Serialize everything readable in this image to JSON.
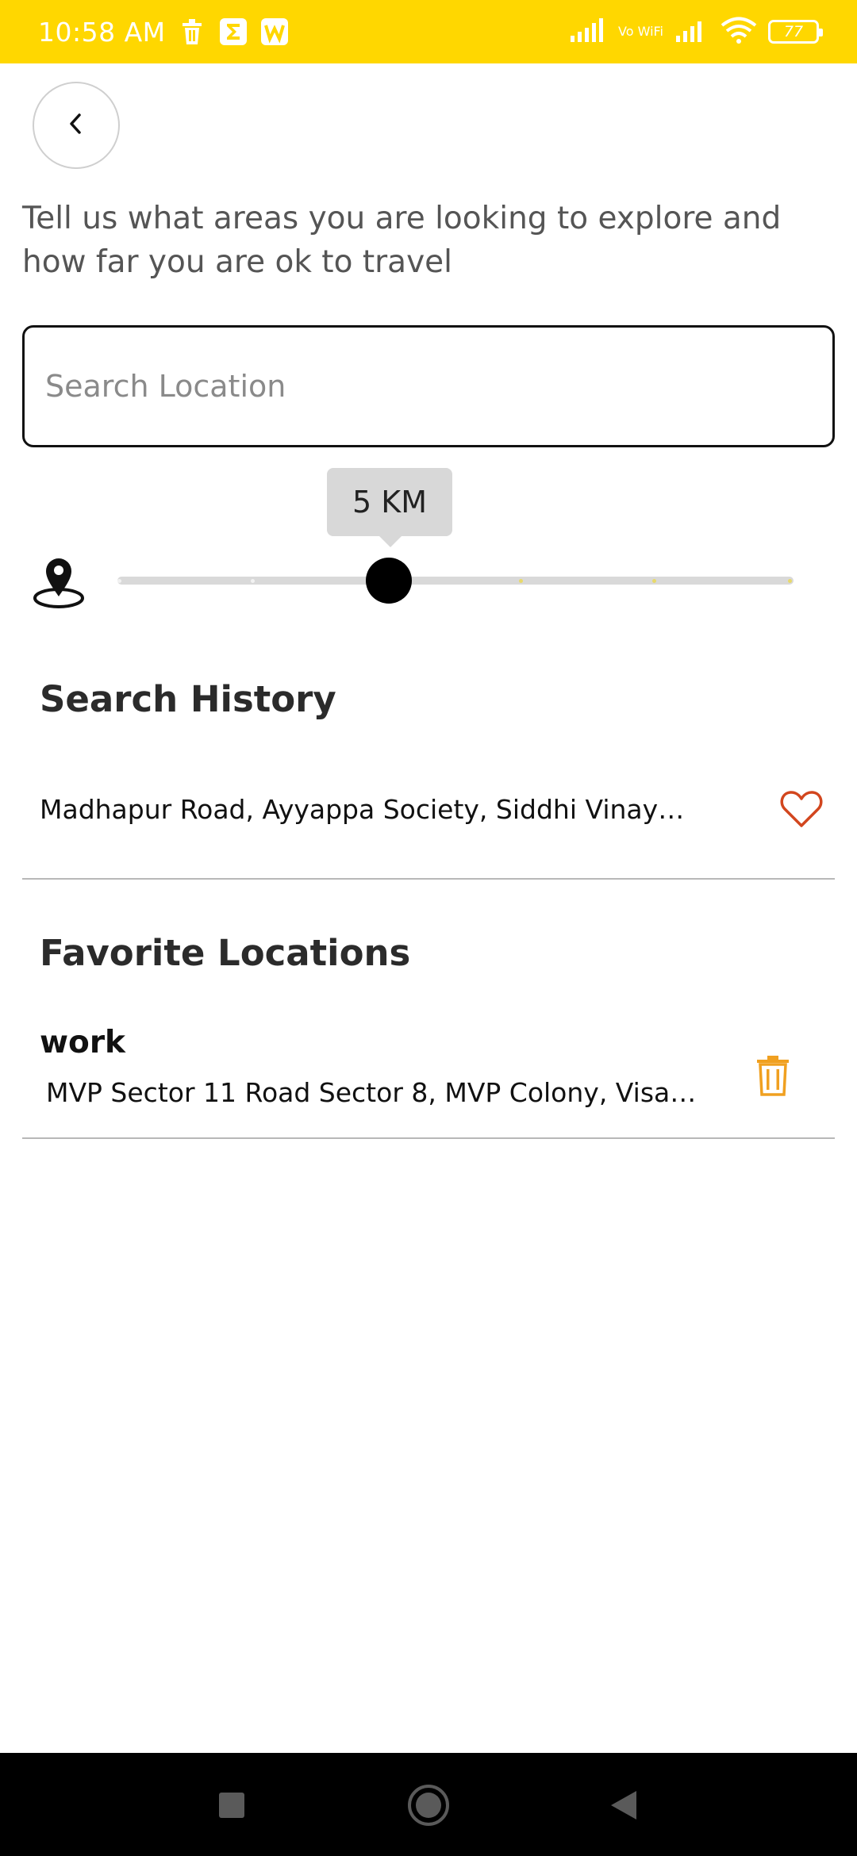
{
  "status_bar": {
    "time": "10:58 AM",
    "vowifi": "Vo WiFi",
    "battery": "77",
    "background_color": "#FFD700"
  },
  "icons": {
    "back": "chevron-left-icon",
    "location_radius": "location-pin-icon",
    "favorite": "heart-icon",
    "delete": "trash-icon"
  },
  "intro_text": "Tell us what areas you are looking to explore and how far you are ok to travel",
  "search": {
    "placeholder": "Search Location",
    "value": ""
  },
  "radius_slider": {
    "label": "5 KM",
    "value_km": 5,
    "fraction": 0.4
  },
  "search_history": {
    "title": "Search History",
    "items": [
      {
        "text": "Madhapur Road, Ayyappa Society, Siddhi Vinaya..."
      }
    ]
  },
  "favorite_locations": {
    "title": "Favorite Locations",
    "items": [
      {
        "name": "work",
        "address": "MVP Sector 11 Road Sector 8, MVP Colony, Visakh..."
      }
    ]
  },
  "colors": {
    "heart": "#D2461E",
    "trash": "#F0A020",
    "accent": "#FFD700"
  }
}
